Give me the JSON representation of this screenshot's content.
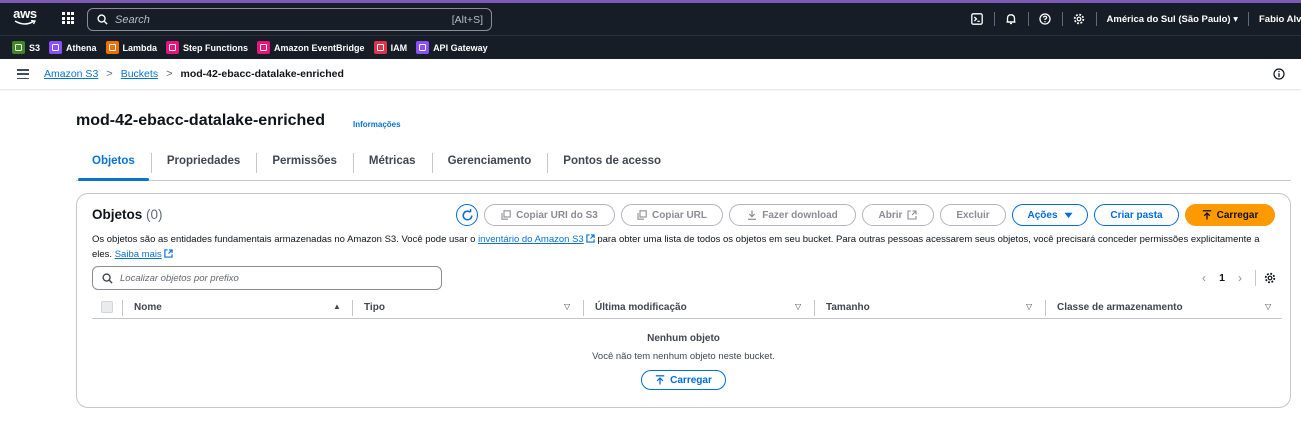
{
  "topnav": {
    "logo_text": "aws",
    "search_placeholder": "Search",
    "search_shortcut": "[Alt+S]",
    "region": "América do Sul (São Paulo) ▾",
    "user": "Fabio Alv",
    "icons": [
      "cloudshell-icon",
      "bell-icon",
      "help-icon",
      "gear-icon"
    ]
  },
  "favorites": [
    {
      "label": "S3",
      "color": "#3f8624",
      "icon": "s3-icon"
    },
    {
      "label": "Athena",
      "color": "#8c4fff",
      "icon": "athena-icon"
    },
    {
      "label": "Lambda",
      "color": "#ed7100",
      "icon": "lambda-icon"
    },
    {
      "label": "Step Functions",
      "color": "#e7157b",
      "icon": "step-functions-icon"
    },
    {
      "label": "Amazon EventBridge",
      "color": "#e7157b",
      "icon": "eventbridge-icon"
    },
    {
      "label": "IAM",
      "color": "#dd344c",
      "icon": "iam-icon"
    },
    {
      "label": "API Gateway",
      "color": "#8c4fff",
      "icon": "api-gateway-icon"
    }
  ],
  "breadcrumb": {
    "items": [
      "Amazon S3",
      "Buckets"
    ],
    "current": "mod-42-ebacc-datalake-enriched",
    "separator": ">"
  },
  "header": {
    "title": "mod-42-ebacc-datalake-enriched",
    "info_link": "Informações"
  },
  "tabs": [
    {
      "label": "Objetos",
      "active": true
    },
    {
      "label": "Propriedades",
      "active": false
    },
    {
      "label": "Permissões",
      "active": false
    },
    {
      "label": "Métricas",
      "active": false
    },
    {
      "label": "Gerenciamento",
      "active": false
    },
    {
      "label": "Pontos de acesso",
      "active": false
    }
  ],
  "objects": {
    "title": "Objetos",
    "count": "(0)",
    "description_1": "Os objetos são as entidades fundamentais armazenadas no Amazon S3. Você pode usar o ",
    "description_link": "inventário do Amazon S3",
    "description_2": " para obter uma lista de todos os objetos em seu bucket. Para outras pessoas acessarem seus objetos, você precisará conceder permissões explicitamente a eles. ",
    "learn_more": "Saiba mais",
    "buttons": {
      "copy_s3_uri": "Copiar URI do S3",
      "copy_url": "Copiar URL",
      "download": "Fazer download",
      "open": "Abrir",
      "delete": "Excluir",
      "actions": "Ações",
      "create_folder": "Criar pasta",
      "upload": "Carregar"
    },
    "filter_placeholder": "Localizar objetos por prefixo",
    "page": "1",
    "columns": [
      "Nome",
      "Tipo",
      "Última modificação",
      "Tamanho",
      "Classe de armazenamento"
    ],
    "empty_title": "Nenhum objeto",
    "empty_subtitle": "Você não tem nenhum objeto neste bucket.",
    "empty_button": "Carregar"
  }
}
